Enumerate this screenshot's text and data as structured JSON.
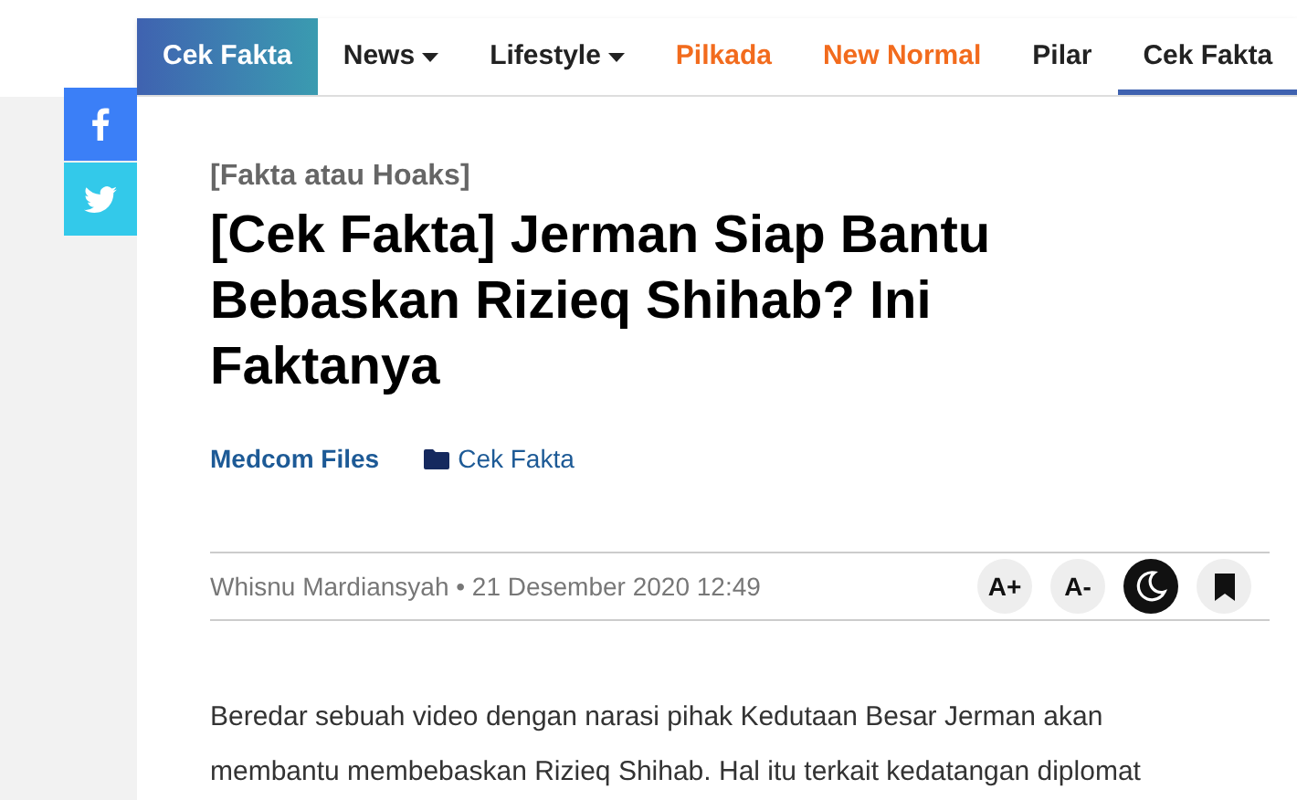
{
  "nav": [
    {
      "label": "Cek Fakta",
      "kind": "brand",
      "dropdown": false,
      "selected": false,
      "color": "#ffffff"
    },
    {
      "label": "News",
      "kind": "link",
      "dropdown": true,
      "selected": false,
      "color": "#222222"
    },
    {
      "label": "Lifestyle",
      "kind": "link",
      "dropdown": true,
      "selected": false,
      "color": "#222222"
    },
    {
      "label": "Pilkada",
      "kind": "link",
      "dropdown": false,
      "selected": false,
      "color": "#f26b1d"
    },
    {
      "label": "New Normal",
      "kind": "link",
      "dropdown": false,
      "selected": false,
      "color": "#f26b1d"
    },
    {
      "label": "Pilar",
      "kind": "link",
      "dropdown": false,
      "selected": false,
      "color": "#222222"
    },
    {
      "label": "Cek Fakta",
      "kind": "link",
      "dropdown": false,
      "selected": true,
      "color": "#222222"
    }
  ],
  "share": [
    {
      "kind": "facebook"
    },
    {
      "kind": "twitter"
    }
  ],
  "article": {
    "kicker": "[Fakta atau Hoaks]",
    "title": "[Cek Fakta] Jerman Siap Bantu Bebaskan Rizieq Shihab? Ini Faktanya",
    "source": "Medcom Files",
    "category": "Cek Fakta",
    "byline": "Whisnu Mardiansyah • 21 Desember 2020 12:49",
    "tools": [
      {
        "kind": "font-up",
        "label": "A+",
        "on": false
      },
      {
        "kind": "font-down",
        "label": "A-",
        "on": false
      },
      {
        "kind": "dark-mode",
        "on": true
      },
      {
        "kind": "bookmark",
        "on": false
      }
    ],
    "body": [
      "Beredar sebuah video dengan narasi pihak Kedutaan Besar Jerman akan",
      "membantu membebaskan Rizieq Shihab. Hal itu terkait kedatangan diplomat"
    ]
  }
}
